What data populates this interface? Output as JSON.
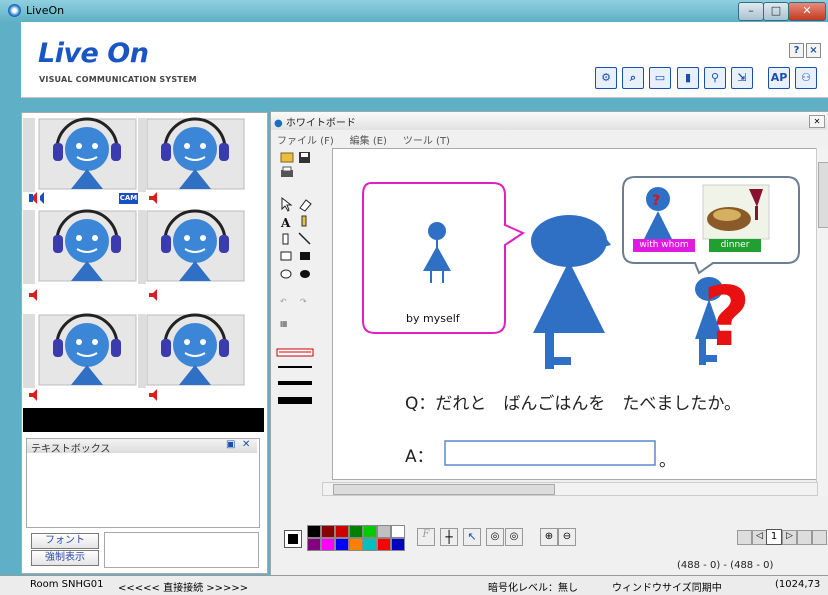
{
  "window": {
    "title": "LiveOn"
  },
  "header": {
    "logo": "Live On",
    "subtitle": "VISUAL COMMUNICATION SYSTEM",
    "help": "?",
    "close": "×",
    "ap_label": "AP"
  },
  "videos": {
    "cam_label": "CAM"
  },
  "textbox": {
    "title": "テキストボックス",
    "font_button": "フォント",
    "force_button": "強制表示"
  },
  "whiteboard": {
    "title": "ホワイトボード",
    "menu": [
      "ファイル (F)",
      "編集 (E)",
      "ツール (T)"
    ],
    "bubble_left_caption": "by myself",
    "tag_with_whom": "with whom",
    "tag_dinner": "dinner",
    "question": "Q：だれと　ばんごはんを　たべましたか。",
    "answer_label": "A：",
    "answer_suffix": "。",
    "page_number": "1",
    "coords": "(488 - 0) - (488 - 0)",
    "palette": [
      "#000000",
      "#8b0000",
      "#d00000",
      "#008000",
      "#00cc00",
      "#c0c0c0",
      "#ffffff",
      "#800080",
      "#ff00ff",
      "#0000ff",
      "#ff8000",
      "#00c0c0",
      "#ff0000",
      "#0000c0"
    ]
  },
  "status": {
    "room": "Room SNHG01",
    "connection": "<<<<< 直接接続 >>>>>",
    "encryption": "暗号化レベル：無し",
    "sync": "ウィンドウサイズ同期中",
    "size": "(1024,73"
  }
}
